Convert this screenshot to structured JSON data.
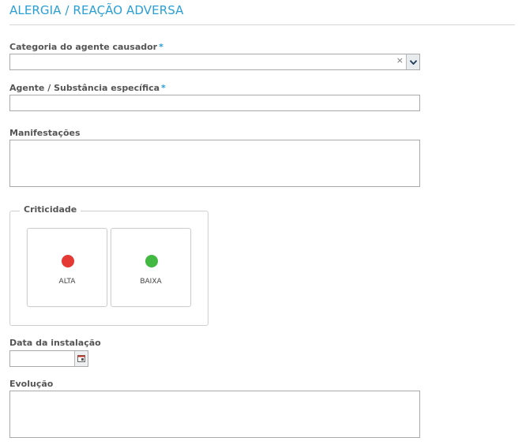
{
  "section": {
    "title": "ALERGIA / REAÇÃO ADVERSA"
  },
  "fields": {
    "categoria": {
      "label": "Categoria do agente causador",
      "required_mark": "*",
      "value": "",
      "clear_glyph": "×"
    },
    "agente": {
      "label": "Agente / Substância específica",
      "required_mark": "*",
      "value": ""
    },
    "manifestacoes": {
      "label": "Manifestações",
      "value": ""
    },
    "data": {
      "label": "Data da instalação",
      "value": ""
    },
    "evolucao": {
      "label": "Evolução",
      "value": ""
    }
  },
  "criticidade": {
    "legend": "Criticidade",
    "options": [
      {
        "label": "ALTA",
        "color": "#e53935"
      },
      {
        "label": "BAIXA",
        "color": "#43b943"
      }
    ]
  },
  "icons": {
    "dropdown": "chevron-down-icon",
    "calendar": "calendar-icon"
  }
}
